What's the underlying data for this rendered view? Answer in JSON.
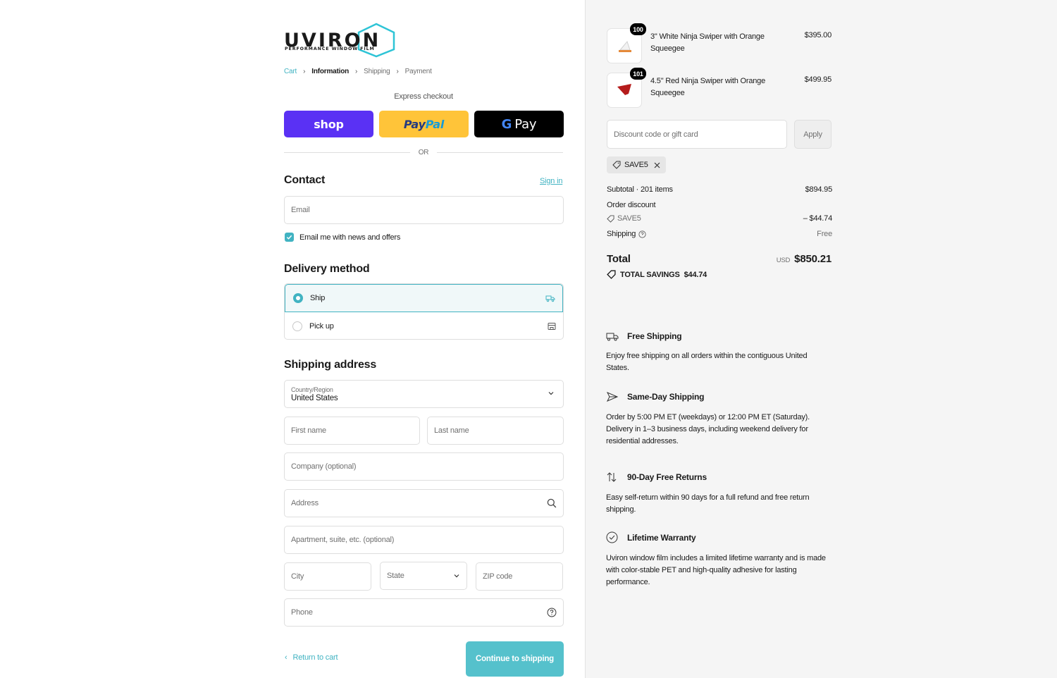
{
  "brand": {
    "wordmark": "UVIRON",
    "tagline": "PERFORMANCE WINDOW FILM",
    "accent": "#41b3c2"
  },
  "breadcrumb": [
    {
      "label": "Cart"
    },
    {
      "label": "Information"
    },
    {
      "label": "Shipping"
    },
    {
      "label": "Payment"
    }
  ],
  "express": {
    "label": "Express checkout",
    "shop": "shop",
    "paypal_a": "Pay",
    "paypal_b": "Pal",
    "gpay_g": "G",
    "gpay": "Pay",
    "or": "OR"
  },
  "contact": {
    "title": "Contact",
    "signin": "Sign in",
    "email_placeholder": "Email",
    "newsletter_label": "Email me with news and offers",
    "newsletter_checked": true
  },
  "delivery": {
    "title": "Delivery method",
    "options": [
      {
        "label": "Ship",
        "icon": "truck-icon",
        "selected": true
      },
      {
        "label": "Pick up",
        "icon": "store-icon",
        "selected": false
      }
    ]
  },
  "shipping": {
    "title": "Shipping address",
    "country_label": "Country/Region",
    "country_value": "United States",
    "first_name": "First name",
    "last_name": "Last name",
    "company": "Company (optional)",
    "address": "Address",
    "apartment": "Apartment, suite, etc. (optional)",
    "city": "City",
    "state": "State",
    "zip": "ZIP code",
    "phone": "Phone"
  },
  "actions": {
    "return": "Return to cart",
    "continue": "Continue to shipping"
  },
  "cart": {
    "items": [
      {
        "qty": "100",
        "name": "3\" White Ninja Swiper with Orange Squeegee",
        "price": "$395.00"
      },
      {
        "qty": "101",
        "name": "4.5\" Red Ninja Swiper with Orange Squeegee",
        "price": "$499.95"
      }
    ],
    "discount_placeholder": "Discount code or gift card",
    "apply": "Apply",
    "code": "SAVE5"
  },
  "summary": {
    "subtotal_label": "Subtotal · 201 items",
    "subtotal_value": "$894.95",
    "order_discount": "Order discount",
    "discount_code": "SAVE5",
    "discount_value": "– $44.74",
    "shipping_label": "Shipping",
    "shipping_value": "Free",
    "total_label": "Total",
    "currency": "USD",
    "total_value": "$850.21",
    "savings_label": "TOTAL SAVINGS",
    "savings_value": "$44.74"
  },
  "features": [
    {
      "title": "Free Shipping",
      "icon": "truck-icon",
      "desc": "Enjoy free shipping on all orders within the contiguous United States."
    },
    {
      "title": "Same-Day Shipping",
      "icon": "plane-icon",
      "desc": "Order by 5:00 PM ET (weekdays) or 12:00 PM ET (Saturday). Delivery in 1–3 business days, including weekend delivery for residential addresses."
    },
    {
      "title": "90-Day Free Returns",
      "icon": "arrows-icon",
      "desc": "Easy self-return within 90 days for a full refund and free return shipping."
    },
    {
      "title": "Lifetime Warranty",
      "icon": "check-circle-icon",
      "desc": "Uviron window film includes a limited lifetime warranty and is made with color-stable PET and high-quality adhesive for lasting performance."
    }
  ]
}
